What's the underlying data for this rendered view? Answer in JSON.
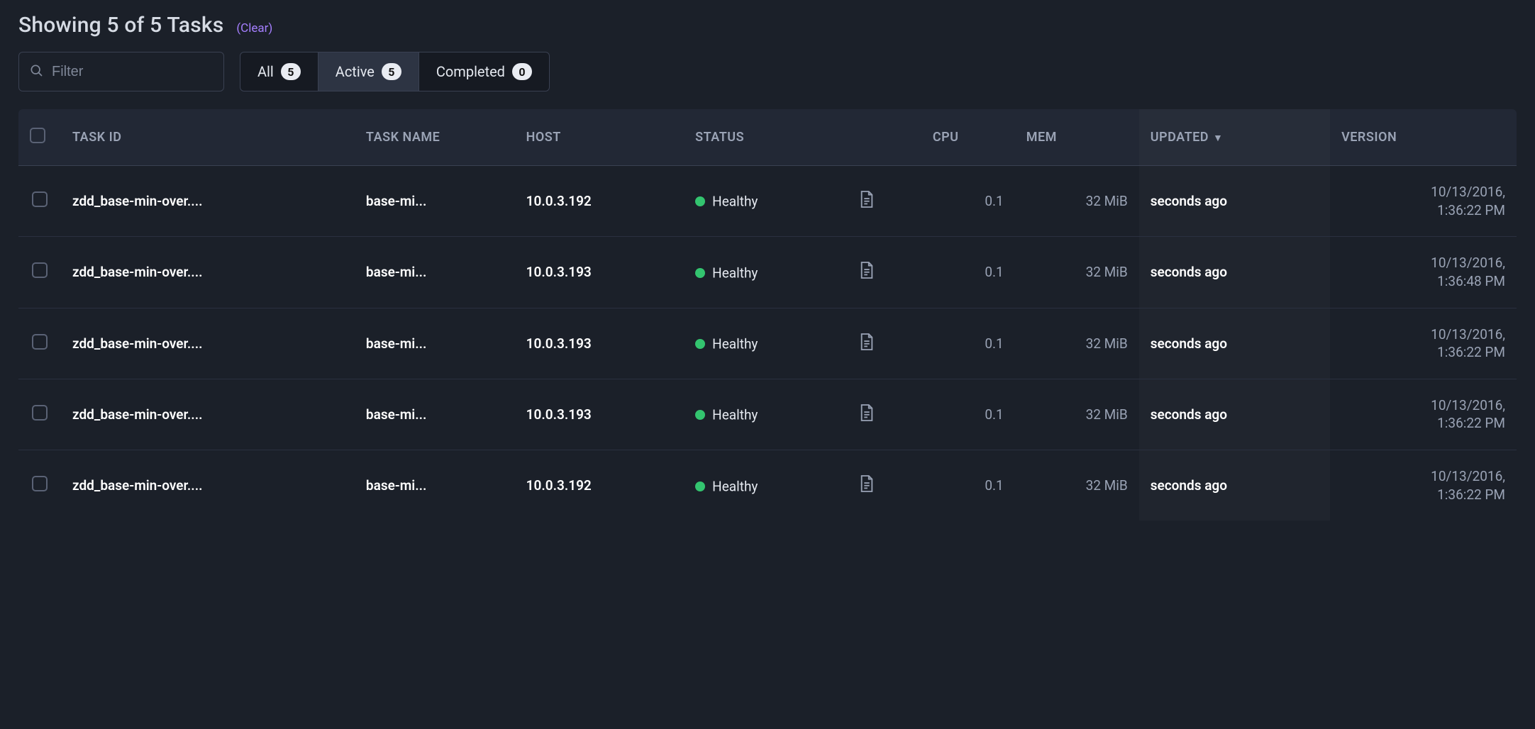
{
  "header": {
    "summary": "Showing 5 of 5 Tasks",
    "clear": "(Clear)"
  },
  "filter": {
    "placeholder": "Filter",
    "value": ""
  },
  "tabs": {
    "all": {
      "label": "All",
      "count": "5"
    },
    "active": {
      "label": "Active",
      "count": "5"
    },
    "completed": {
      "label": "Completed",
      "count": "0"
    }
  },
  "columns": {
    "task_id": "TASK ID",
    "task_name": "TASK NAME",
    "host": "HOST",
    "status": "STATUS",
    "cpu": "CPU",
    "mem": "MEM",
    "updated": "UPDATED",
    "version": "VERSION"
  },
  "rows": [
    {
      "task_id": "zdd_base-min-over....",
      "task_name": "base-mi...",
      "host": "10.0.3.192",
      "status": "Healthy",
      "cpu": "0.1",
      "mem": "32 MiB",
      "updated": "seconds ago",
      "version": "10/13/2016, 1:36:22 PM"
    },
    {
      "task_id": "zdd_base-min-over....",
      "task_name": "base-mi...",
      "host": "10.0.3.193",
      "status": "Healthy",
      "cpu": "0.1",
      "mem": "32 MiB",
      "updated": "seconds ago",
      "version": "10/13/2016, 1:36:48 PM"
    },
    {
      "task_id": "zdd_base-min-over....",
      "task_name": "base-mi...",
      "host": "10.0.3.193",
      "status": "Healthy",
      "cpu": "0.1",
      "mem": "32 MiB",
      "updated": "seconds ago",
      "version": "10/13/2016, 1:36:22 PM"
    },
    {
      "task_id": "zdd_base-min-over....",
      "task_name": "base-mi...",
      "host": "10.0.3.193",
      "status": "Healthy",
      "cpu": "0.1",
      "mem": "32 MiB",
      "updated": "seconds ago",
      "version": "10/13/2016, 1:36:22 PM"
    },
    {
      "task_id": "zdd_base-min-over....",
      "task_name": "base-mi...",
      "host": "10.0.3.192",
      "status": "Healthy",
      "cpu": "0.1",
      "mem": "32 MiB",
      "updated": "seconds ago",
      "version": "10/13/2016, 1:36:22 PM"
    }
  ]
}
